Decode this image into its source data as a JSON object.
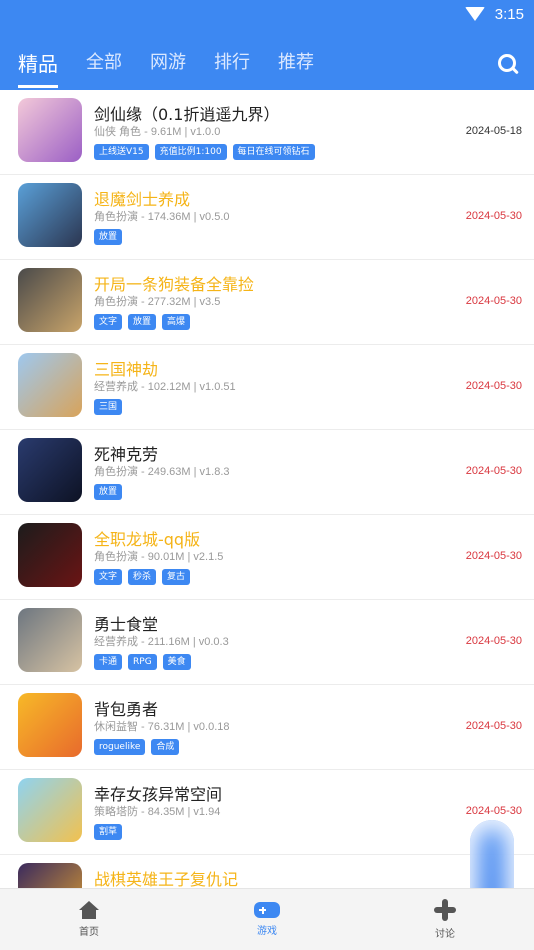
{
  "status": {
    "time": "3:15"
  },
  "tabs": [
    "精品",
    "全部",
    "网游",
    "排行",
    "推荐"
  ],
  "games": [
    {
      "title": "剑仙缘（0.1折逍遥九界）",
      "meta": "仙侠 角色 - 9.61M | v1.0.0",
      "tags": [
        "上线送V15",
        "充值比例1:100",
        "每日在线可领钻石"
      ],
      "date": "2024-05-18",
      "highlight": false,
      "date_red": false,
      "icon_colors": [
        "#f3c9d9",
        "#9b5fc5"
      ]
    },
    {
      "title": "退魔剑士养成",
      "meta": "角色扮演 - 174.36M | v0.5.0",
      "tags": [
        "放置"
      ],
      "date": "2024-05-30",
      "highlight": true,
      "date_red": true,
      "icon_colors": [
        "#5aa0d8",
        "#2b3550"
      ]
    },
    {
      "title": "开局一条狗装备全靠捡",
      "meta": "角色扮演 - 277.32M | v3.5",
      "tags": [
        "文字",
        "放置",
        "高爆"
      ],
      "date": "2024-05-30",
      "highlight": true,
      "date_red": true,
      "icon_colors": [
        "#4a4a4a",
        "#c9a46a"
      ]
    },
    {
      "title": "三国神劫",
      "meta": "经营养成 - 102.12M | v1.0.51",
      "tags": [
        "三国"
      ],
      "date": "2024-05-30",
      "highlight": true,
      "date_red": true,
      "icon_colors": [
        "#9ec8ef",
        "#d8a35a"
      ]
    },
    {
      "title": "死神克劳",
      "meta": "角色扮演 - 249.63M | v1.8.3",
      "tags": [
        "放置"
      ],
      "date": "2024-05-30",
      "highlight": false,
      "date_red": true,
      "icon_colors": [
        "#2a3b6e",
        "#0d1224"
      ]
    },
    {
      "title": "全职龙城-qq版",
      "meta": "角色扮演 - 90.01M | v2.1.5",
      "tags": [
        "文字",
        "秒杀",
        "复古"
      ],
      "date": "2024-05-30",
      "highlight": true,
      "date_red": true,
      "icon_colors": [
        "#1c1c1c",
        "#6b1414"
      ]
    },
    {
      "title": "勇士食堂",
      "meta": "经营养成 - 211.16M | v0.0.3",
      "tags": [
        "卡通",
        "RPG",
        "美食"
      ],
      "date": "2024-05-30",
      "highlight": false,
      "date_red": true,
      "icon_colors": [
        "#6d7680",
        "#d7c3a3"
      ]
    },
    {
      "title": "背包勇者",
      "meta": "休闲益智 - 76.31M | v0.0.18",
      "tags": [
        "roguelike",
        "合成"
      ],
      "date": "2024-05-30",
      "highlight": false,
      "date_red": true,
      "icon_colors": [
        "#f7b928",
        "#e86a2c"
      ]
    },
    {
      "title": "幸存女孩异常空间",
      "meta": "策略塔防 - 84.35M | v1.94",
      "tags": [
        "割草"
      ],
      "date": "2024-05-30",
      "highlight": false,
      "date_red": true,
      "icon_colors": [
        "#8fd3f0",
        "#f2c14e"
      ]
    },
    {
      "title": "战棋英雄王子复仇记",
      "meta": "",
      "tags": [],
      "date": "",
      "highlight": true,
      "date_red": true,
      "icon_colors": [
        "#3a2a5e",
        "#e0a030"
      ]
    }
  ],
  "bottom_nav": [
    {
      "label": "首页",
      "icon": "home-icon",
      "active": false
    },
    {
      "label": "游戏",
      "icon": "gamepad-icon",
      "active": true
    },
    {
      "label": "讨论",
      "icon": "fan-icon",
      "active": false
    }
  ],
  "colors": {
    "primary": "#3d88f2",
    "highlight_title": "#f5b418",
    "date_red": "#d9363e"
  }
}
